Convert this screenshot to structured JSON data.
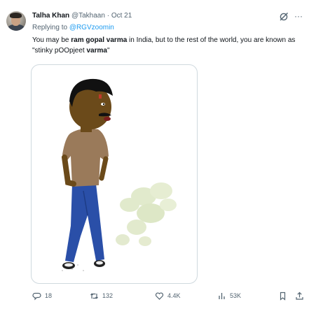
{
  "tweet": {
    "author_name": "Talha Khan",
    "author_handle": "@Takhaan",
    "separator": "·",
    "date": "Oct 21",
    "replying_prefix": "Replying to ",
    "replying_to": "@RGVzoomin",
    "text": {
      "p1": "You may be ",
      "b1": "ram gopal varma",
      "p2": " in India, but to the rest of the world, you are known as \"stinky pOOpjeet ",
      "b2": "varma",
      "p3": "\""
    }
  },
  "actions": {
    "replies": "18",
    "reposts": "132",
    "likes": "4.4K",
    "views": "53K"
  },
  "colors": {
    "text": "#0f1419",
    "secondary": "#536471",
    "link": "#1d9bf0",
    "border": "#cfd9de"
  },
  "icons": [
    "grok-icon",
    "more-icon",
    "reply-icon",
    "repost-icon",
    "like-icon",
    "views-icon",
    "bookmark-icon",
    "share-icon"
  ]
}
